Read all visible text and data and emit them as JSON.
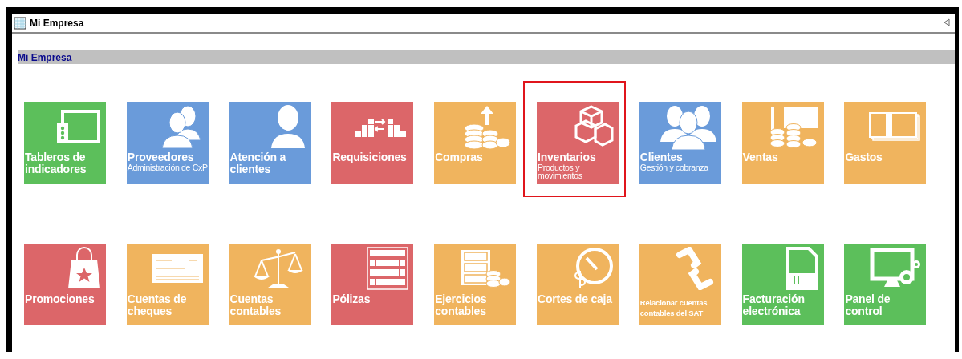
{
  "window": {
    "tab": "Mi Empresa"
  },
  "section": {
    "title": "Mi Empresa"
  },
  "tiles": [
    {
      "kind": "large",
      "title": "Tableros de indicadores",
      "color": "#5cbf5b",
      "selected": false
    },
    {
      "kind": "large",
      "title": "Proveedores",
      "subtitle": "Administración de CxP",
      "color": "#6a9bda",
      "selected": false
    },
    {
      "kind": "large",
      "title": "Atención a clientes",
      "color": "#6a9bda",
      "selected": false
    },
    {
      "kind": "large",
      "title": "Requisiciones",
      "color": "#dc6669",
      "selected": false
    },
    {
      "kind": "large",
      "title": "Compras",
      "color": "#f0b45e",
      "selected": false
    },
    {
      "kind": "large",
      "title": "Inventarios",
      "subtitle": "Productos y movimientos",
      "color": "#dc6669",
      "selected": true
    },
    {
      "kind": "large",
      "title": "Clientes",
      "subtitle": "Gestión y cobranza",
      "color": "#6a9bda",
      "selected": false
    },
    {
      "kind": "large",
      "title": "Ventas",
      "color": "#f0b45e",
      "selected": false
    },
    {
      "kind": "large",
      "title": "Gastos",
      "color": "#f0b45e",
      "selected": false
    },
    {
      "kind": "large",
      "title": "Promociones",
      "color": "#dc6669",
      "selected": false
    },
    {
      "kind": "large",
      "title": "Cuentas de cheques",
      "color": "#f0b45e",
      "selected": false
    },
    {
      "kind": "large",
      "title": "Cuentas contables",
      "color": "#f0b45e",
      "selected": false
    },
    {
      "kind": "large",
      "title": "Pólizas",
      "color": "#dc6669",
      "selected": false
    },
    {
      "kind": "large",
      "title": "Ejercicios contables",
      "color": "#f0b45e",
      "selected": false
    },
    {
      "kind": "large",
      "title": "Cortes de caja",
      "color": "#f0b45e",
      "selected": false
    },
    {
      "kind": "small",
      "title": "Relacionar cuentas contables del SAT",
      "color": "#f0b45e",
      "selected": false
    },
    {
      "kind": "large",
      "title": "Facturación electrónica",
      "color": "#5cbf5b",
      "selected": false
    },
    {
      "kind": "large",
      "title": "Panel de control",
      "color": "#5cbf5b",
      "selected": false
    }
  ]
}
